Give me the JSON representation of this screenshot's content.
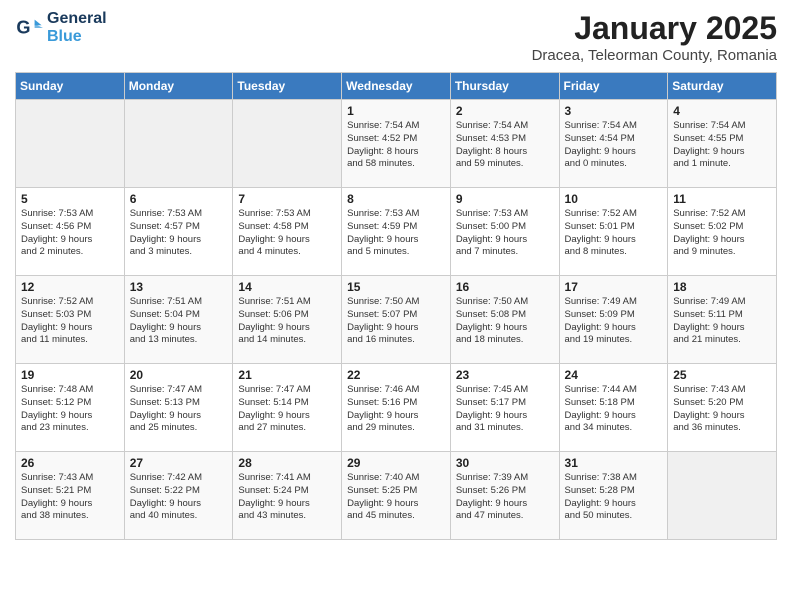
{
  "header": {
    "logo_line1": "General",
    "logo_line2": "Blue",
    "title": "January 2025",
    "subtitle": "Dracea, Teleorman County, Romania"
  },
  "days_of_week": [
    "Sunday",
    "Monday",
    "Tuesday",
    "Wednesday",
    "Thursday",
    "Friday",
    "Saturday"
  ],
  "weeks": [
    [
      {
        "day": "",
        "content": ""
      },
      {
        "day": "",
        "content": ""
      },
      {
        "day": "",
        "content": ""
      },
      {
        "day": "1",
        "content": "Sunrise: 7:54 AM\nSunset: 4:52 PM\nDaylight: 8 hours\nand 58 minutes."
      },
      {
        "day": "2",
        "content": "Sunrise: 7:54 AM\nSunset: 4:53 PM\nDaylight: 8 hours\nand 59 minutes."
      },
      {
        "day": "3",
        "content": "Sunrise: 7:54 AM\nSunset: 4:54 PM\nDaylight: 9 hours\nand 0 minutes."
      },
      {
        "day": "4",
        "content": "Sunrise: 7:54 AM\nSunset: 4:55 PM\nDaylight: 9 hours\nand 1 minute."
      }
    ],
    [
      {
        "day": "5",
        "content": "Sunrise: 7:53 AM\nSunset: 4:56 PM\nDaylight: 9 hours\nand 2 minutes."
      },
      {
        "day": "6",
        "content": "Sunrise: 7:53 AM\nSunset: 4:57 PM\nDaylight: 9 hours\nand 3 minutes."
      },
      {
        "day": "7",
        "content": "Sunrise: 7:53 AM\nSunset: 4:58 PM\nDaylight: 9 hours\nand 4 minutes."
      },
      {
        "day": "8",
        "content": "Sunrise: 7:53 AM\nSunset: 4:59 PM\nDaylight: 9 hours\nand 5 minutes."
      },
      {
        "day": "9",
        "content": "Sunrise: 7:53 AM\nSunset: 5:00 PM\nDaylight: 9 hours\nand 7 minutes."
      },
      {
        "day": "10",
        "content": "Sunrise: 7:52 AM\nSunset: 5:01 PM\nDaylight: 9 hours\nand 8 minutes."
      },
      {
        "day": "11",
        "content": "Sunrise: 7:52 AM\nSunset: 5:02 PM\nDaylight: 9 hours\nand 9 minutes."
      }
    ],
    [
      {
        "day": "12",
        "content": "Sunrise: 7:52 AM\nSunset: 5:03 PM\nDaylight: 9 hours\nand 11 minutes."
      },
      {
        "day": "13",
        "content": "Sunrise: 7:51 AM\nSunset: 5:04 PM\nDaylight: 9 hours\nand 13 minutes."
      },
      {
        "day": "14",
        "content": "Sunrise: 7:51 AM\nSunset: 5:06 PM\nDaylight: 9 hours\nand 14 minutes."
      },
      {
        "day": "15",
        "content": "Sunrise: 7:50 AM\nSunset: 5:07 PM\nDaylight: 9 hours\nand 16 minutes."
      },
      {
        "day": "16",
        "content": "Sunrise: 7:50 AM\nSunset: 5:08 PM\nDaylight: 9 hours\nand 18 minutes."
      },
      {
        "day": "17",
        "content": "Sunrise: 7:49 AM\nSunset: 5:09 PM\nDaylight: 9 hours\nand 19 minutes."
      },
      {
        "day": "18",
        "content": "Sunrise: 7:49 AM\nSunset: 5:11 PM\nDaylight: 9 hours\nand 21 minutes."
      }
    ],
    [
      {
        "day": "19",
        "content": "Sunrise: 7:48 AM\nSunset: 5:12 PM\nDaylight: 9 hours\nand 23 minutes."
      },
      {
        "day": "20",
        "content": "Sunrise: 7:47 AM\nSunset: 5:13 PM\nDaylight: 9 hours\nand 25 minutes."
      },
      {
        "day": "21",
        "content": "Sunrise: 7:47 AM\nSunset: 5:14 PM\nDaylight: 9 hours\nand 27 minutes."
      },
      {
        "day": "22",
        "content": "Sunrise: 7:46 AM\nSunset: 5:16 PM\nDaylight: 9 hours\nand 29 minutes."
      },
      {
        "day": "23",
        "content": "Sunrise: 7:45 AM\nSunset: 5:17 PM\nDaylight: 9 hours\nand 31 minutes."
      },
      {
        "day": "24",
        "content": "Sunrise: 7:44 AM\nSunset: 5:18 PM\nDaylight: 9 hours\nand 34 minutes."
      },
      {
        "day": "25",
        "content": "Sunrise: 7:43 AM\nSunset: 5:20 PM\nDaylight: 9 hours\nand 36 minutes."
      }
    ],
    [
      {
        "day": "26",
        "content": "Sunrise: 7:43 AM\nSunset: 5:21 PM\nDaylight: 9 hours\nand 38 minutes."
      },
      {
        "day": "27",
        "content": "Sunrise: 7:42 AM\nSunset: 5:22 PM\nDaylight: 9 hours\nand 40 minutes."
      },
      {
        "day": "28",
        "content": "Sunrise: 7:41 AM\nSunset: 5:24 PM\nDaylight: 9 hours\nand 43 minutes."
      },
      {
        "day": "29",
        "content": "Sunrise: 7:40 AM\nSunset: 5:25 PM\nDaylight: 9 hours\nand 45 minutes."
      },
      {
        "day": "30",
        "content": "Sunrise: 7:39 AM\nSunset: 5:26 PM\nDaylight: 9 hours\nand 47 minutes."
      },
      {
        "day": "31",
        "content": "Sunrise: 7:38 AM\nSunset: 5:28 PM\nDaylight: 9 hours\nand 50 minutes."
      },
      {
        "day": "",
        "content": ""
      }
    ]
  ]
}
